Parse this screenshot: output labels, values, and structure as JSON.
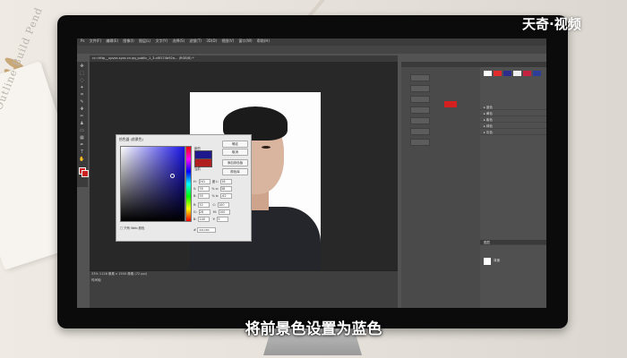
{
  "background": {
    "notebook_text": "Outline Build Pend"
  },
  "brand": {
    "watermark": "天奇·视频"
  },
  "caption": {
    "subtitle": "将前景色设置为蓝色"
  },
  "photoshop": {
    "menu": [
      "Ps",
      "文件(F)",
      "编辑(E)",
      "图像(I)",
      "图层(L)",
      "文字(Y)",
      "选择(S)",
      "滤镜(T)",
      "3D(D)",
      "视图(V)",
      "窗口(W)",
      "帮助(H)"
    ],
    "document_tab": "cc=http__upvzz.xyzz.cn.qq_public_1_3.c8f174b92a... (RGB/8) *",
    "status": "33%  1126 像素 x 1500 像素 (72 ppi)",
    "timeline_label": "时间轴",
    "foreground_color": "#cc1e1e",
    "color_picker": {
      "title": "拾色器 (前景色)",
      "new_label": "新的",
      "current_label": "当前",
      "ok": "确定",
      "cancel": "取消",
      "add_to_swatches": "添加到色板",
      "color_libraries": "颜色库",
      "only_web_colors": "只有 Web 颜色",
      "values": [
        {
          "label": "H:",
          "value": "241",
          "unit": "度",
          "label2": "L:",
          "value2": "16"
        },
        {
          "label": "S:",
          "value": "78",
          "unit": "%",
          "label2": "a:",
          "value2": "38"
        },
        {
          "label": "B:",
          "value": "55",
          "unit": "%",
          "label2": "b:",
          "value2": "-62"
        },
        {
          "label": "R:",
          "value": "32",
          "unit": "",
          "label2": "C:",
          "value2": "100"
        },
        {
          "label": "G:",
          "value": "28",
          "unit": "",
          "label2": "M:",
          "value2": "100"
        },
        {
          "label": "B:",
          "value": "140",
          "unit": "",
          "label2": "Y:",
          "value2": "5"
        }
      ],
      "hex_label": "#",
      "hex": "201C8C",
      "new_color": "#1e1a8e",
      "current_color": "#b02020"
    },
    "panels": {
      "layers_title": "图层",
      "layer_name": "背景",
      "groups": [
        "▸ 蓝色",
        "▸ 黄色",
        "▸ 紫色",
        "▸ 绿色",
        "▸ 灰色"
      ]
    }
  }
}
